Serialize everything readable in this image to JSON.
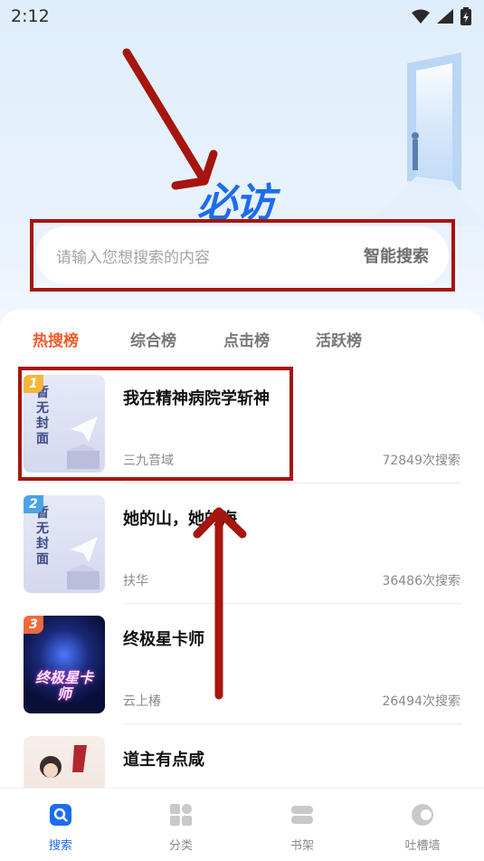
{
  "status": {
    "time": "2:12"
  },
  "logo": {
    "main": "必",
    "dot_char": "访",
    "full": "必访"
  },
  "search": {
    "placeholder": "请输入您想搜索的内容",
    "button": "智能搜索"
  },
  "tabs": [
    {
      "label": "热搜榜",
      "active": true
    },
    {
      "label": "综合榜",
      "active": false
    },
    {
      "label": "点击榜",
      "active": false
    },
    {
      "label": "活跃榜",
      "active": false
    }
  ],
  "list": [
    {
      "rank": "1",
      "title": "我在精神病院学斩神",
      "author": "三九音域",
      "count": "72849次搜索",
      "cover_text": "暂无封面",
      "rank_color": "#f4b63a"
    },
    {
      "rank": "2",
      "title": "她的山，她的海",
      "author": "扶华",
      "count": "36486次搜索",
      "cover_text": "暂无封面",
      "rank_color": "#4aa3e8"
    },
    {
      "rank": "3",
      "title": "终极星卡师",
      "author": "云上椿",
      "count": "26494次搜索",
      "cover_text": "终极星卡师",
      "rank_color": "#ef6a3c"
    },
    {
      "rank": "",
      "title": "道主有点咸",
      "author": "",
      "count": "",
      "cover_text": "",
      "rank_color": ""
    }
  ],
  "nav": [
    {
      "label": "搜索",
      "icon": "search-icon",
      "active": true
    },
    {
      "label": "分类",
      "icon": "category-icon",
      "active": false
    },
    {
      "label": "书架",
      "icon": "bookshelf-icon",
      "active": false
    },
    {
      "label": "吐槽墙",
      "icon": "comment-wall-icon",
      "active": false
    }
  ],
  "colors": {
    "accent": "#1c6cf0",
    "hot": "#f25a2a",
    "annotation": "#a6150e"
  }
}
